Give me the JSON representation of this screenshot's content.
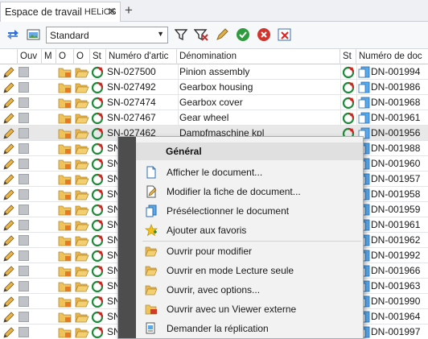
{
  "tab": {
    "title": "Espace de travail",
    "subtitle": "HELiOS",
    "close": "✕",
    "add": "+"
  },
  "toolbar": {
    "view_select": "Standard"
  },
  "columns": {
    "ouv": "Ouv",
    "m": "M",
    "o1": "O",
    "o2": "O",
    "st": "St",
    "numero": "Numéro d'artic",
    "denomination": "Dénomination",
    "st2": "St",
    "docnum": "Numéro de doc"
  },
  "rows": [
    {
      "sn": "SN-027500",
      "name": "Pinion assembly",
      "dn": "DN-001994"
    },
    {
      "sn": "SN-027492",
      "name": "Gearbox housing",
      "dn": "DN-001986"
    },
    {
      "sn": "SN-027474",
      "name": "Gearbox cover",
      "dn": "DN-001968"
    },
    {
      "sn": "SN-027467",
      "name": "Gear wheel",
      "dn": "DN-001961"
    },
    {
      "sn": "SN-027462",
      "name": "Dampfmaschine kpl",
      "dn": "DN-001956"
    },
    {
      "sn": "SN",
      "name": "",
      "dn": "DN-001988"
    },
    {
      "sn": "SN",
      "name": "",
      "dn": "DN-001960"
    },
    {
      "sn": "SN",
      "name": "",
      "dn": "DN-001957"
    },
    {
      "sn": "SN",
      "name": "",
      "dn": "DN-001958"
    },
    {
      "sn": "SN",
      "name": "",
      "dn": "DN-001959"
    },
    {
      "sn": "SN",
      "name": "",
      "dn": "DN-001961"
    },
    {
      "sn": "SN",
      "name": "",
      "dn": "DN-001962"
    },
    {
      "sn": "SN",
      "name": "",
      "dn": "DN-001992"
    },
    {
      "sn": "SN",
      "name": "",
      "dn": "DN-001966"
    },
    {
      "sn": "SN",
      "name": "",
      "dn": "DN-001963"
    },
    {
      "sn": "SN",
      "name": "",
      "dn": "DN-001990"
    },
    {
      "sn": "SN",
      "name": "",
      "dn": "DN-001964"
    },
    {
      "sn": "SN",
      "name": "",
      "dn": "DN-001997"
    }
  ],
  "menu": {
    "header": "Général",
    "items": [
      {
        "label": "Afficher le document...",
        "icon": "document-icon"
      },
      {
        "label": "Modifier la fiche de document...",
        "icon": "edit-document-icon"
      },
      {
        "label": "Présélectionner le document",
        "icon": "preselect-document-icon"
      },
      {
        "label": "Ajouter aux favoris",
        "icon": "favorite-star-icon"
      },
      {
        "label": "Ouvrir pour modifier",
        "icon": "folder-open-icon"
      },
      {
        "label": "Ouvrir en mode Lecture seule",
        "icon": "folder-readonly-icon"
      },
      {
        "label": "Ouvrir, avec options...",
        "icon": "folder-options-icon"
      },
      {
        "label": "Ouvrir avec un Viewer externe",
        "icon": "folder-viewer-icon"
      },
      {
        "label": "Demander la réplication",
        "icon": "replication-icon"
      }
    ]
  },
  "colors": {
    "accent": "#2f6fd6",
    "menu_strip": "#4d4d4d",
    "selected_row": "#e8e8e8"
  }
}
